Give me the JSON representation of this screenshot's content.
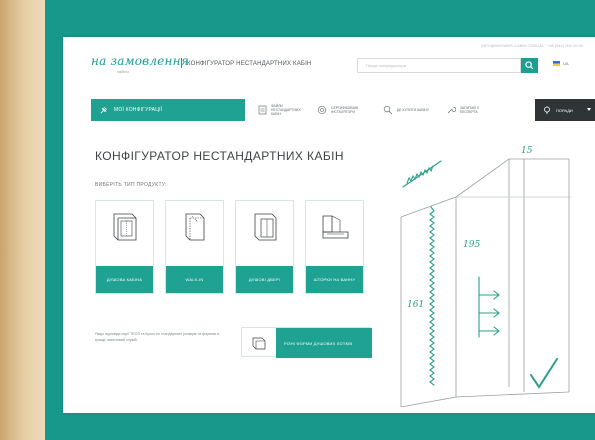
{
  "header": {
    "topline": "INFO@SHOWER-CABIN.COM.UA · +38 (044) 000 00 00",
    "logo": "на замовлення",
    "logo_sub": "кабіни",
    "site_title": "КОНФІГУРАТОР НЕСТАНДАРТНИХ КАБІН",
    "search_placeholder": "Пошук конфігуратора",
    "language": "UA"
  },
  "nav": {
    "first_label": "МОЇ КОНФІГУРАЦІЇ",
    "items": [
      {
        "label": "ФАЙЛИ НЕСТАНДАРТНИХ КАБІН",
        "icon": "file-icon"
      },
      {
        "label": "СЕРТИФІКОВАНІ ІНСТАЛЯТОРИ",
        "icon": "certificate-icon"
      },
      {
        "label": "ДЕ КУПИТИ КАБІНУ",
        "icon": "search-store-icon"
      },
      {
        "label": "ЗАПИТАЙ З ЕКСПЕРТА",
        "icon": "wrench-icon"
      }
    ],
    "tips_label": "ПОРАДИ"
  },
  "main": {
    "title": "КОНФІГУРАТОР НЕСТАНДАРТНИХ КАБІН",
    "choose_label": "ВИБЕРІТЬ ТИП ПРОДУКТУ:",
    "products": [
      {
        "label": "ДУШОВА КАБІНА",
        "icon": "shower-cabin-icon"
      },
      {
        "label": "WALK-IN",
        "icon": "walk-in-icon"
      },
      {
        "label": "ДУШОВІ ДВЕРІ",
        "icon": "shower-door-icon"
      },
      {
        "label": "ШТОРКИ НА ВАННУ",
        "icon": "bath-screen-icon"
      }
    ],
    "info_text": "Якщо відповідь серії TEOS та Кросс не стандартних розмірів та формою в краще, випитовий службі.",
    "tray_button_label": "РІЗНІ ФОРМИ ДУШОВИХ ЛОТКІВ"
  },
  "sketch": {
    "dim_top": "15",
    "dim_height": "195",
    "dim_side": "161"
  },
  "colors": {
    "teal": "#20a292",
    "frame_teal": "#17988a",
    "dark_button": "#2f3437"
  }
}
